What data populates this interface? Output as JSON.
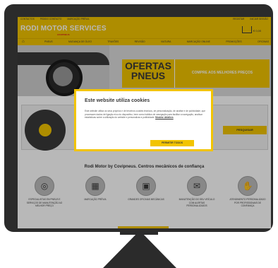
{
  "top_strip": {
    "left_links": [
      "CONTACTOS",
      "PEDIDO CONTACTO",
      "MARCAÇÃO PRÉVIA"
    ],
    "right_links": [
      "REGISTAR",
      "INICIAR SESSÃO"
    ]
  },
  "header": {
    "brand": "RODI MOTOR SERVICES",
    "brand_sub": "COVIPNEUS",
    "cart_total": "€ 0,00"
  },
  "nav": {
    "items": [
      "PNEUS",
      "MUDANÇA DE ÓLEO",
      "TRAVÕES",
      "REVISÃO",
      "VIATURA",
      "MARCAÇÃO ONLINE",
      "PROMOÇÕES",
      "OFICINAS"
    ]
  },
  "hero": {
    "offer": "OFERTAS PNEUS",
    "banner": "COMPRE AOS MELHORES PREÇOS"
  },
  "search": {
    "button": "PESQUISAR"
  },
  "section": {
    "title": "Rodi Motor by Covipneus. Centros mecânicos de confiança"
  },
  "features": [
    {
      "icon": "tyre-icon",
      "label": "ESPECIALISTAS EM PNEUS E SERVIÇOS DE MANUTENÇÃO AO MELHOR PREÇO"
    },
    {
      "icon": "calendar-icon",
      "label": "MARCAÇÃO PRÉVIA"
    },
    {
      "icon": "workshop-icon",
      "label": "GRANDES OFICINAS MECÂNICAS"
    },
    {
      "icon": "alert-icon",
      "label": "MANUTENÇÃO DO SEU VEÍCULO COM ALERTAS PERSONALIZADOS"
    },
    {
      "icon": "handshake-icon",
      "label": "ATENDIMENTO PERSONALIZADO POR PROFISSIONAIS DE CONFIANÇA"
    }
  ],
  "cookie": {
    "title": "Este website utiliza cookies",
    "text": "Este website utiliza os seus próprios e de terceiros cookies técnicos, de personalização, de análise e de publicidade, que processam dados de ligação e/ou do dispositivo, bem como hábitos de navegação para facilitar a navegação, analisar estatísticas sobre a utilização do website e personalizar a publicidade.",
    "link": "Mostrar detalhes",
    "button": "PERMITIR TODOS"
  },
  "colors": {
    "brand_yellow": "#f2c400",
    "dark": "#3a3a3a",
    "monitor": "#2b2b2b"
  }
}
